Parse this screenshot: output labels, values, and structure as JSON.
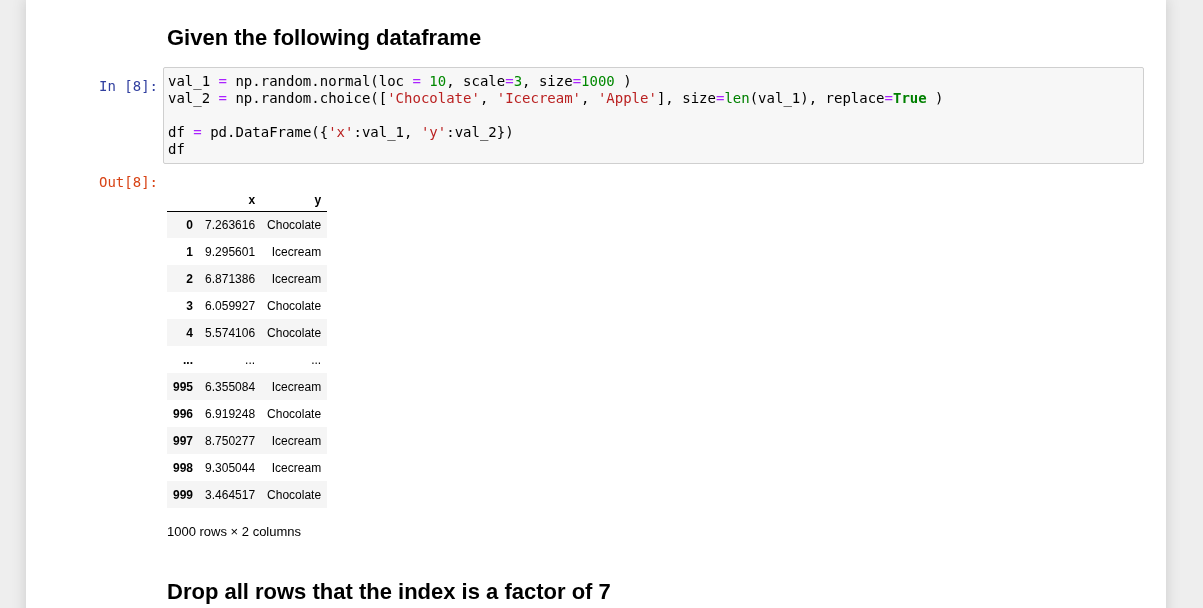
{
  "notebook": {
    "cells": [
      {
        "kind": "markdown",
        "heading": "Given the following dataframe"
      },
      {
        "kind": "code",
        "prompt": "In [8]:",
        "blocks": [
          [
            [
              {
                "kind": "plain",
                "text": "val_1 "
              },
              {
                "kind": "op",
                "text": "="
              },
              {
                "kind": "plain",
                "text": " np.random.normal(loc "
              },
              {
                "kind": "op",
                "text": "= "
              },
              {
                "kind": "number",
                "text": "10"
              },
              {
                "kind": "plain",
                "text": ", scale"
              },
              {
                "kind": "op",
                "text": "="
              },
              {
                "kind": "number",
                "text": "3"
              },
              {
                "kind": "plain",
                "text": ", size"
              },
              {
                "kind": "op",
                "text": "="
              },
              {
                "kind": "number",
                "text": "1000"
              },
              {
                "kind": "plain",
                "text": " )"
              }
            ],
            [
              {
                "kind": "plain",
                "text": "val_2 "
              },
              {
                "kind": "op",
                "text": "="
              },
              {
                "kind": "plain",
                "text": " np.random.choice(["
              },
              {
                "kind": "string",
                "text": "'Chocolate'"
              },
              {
                "kind": "plain",
                "text": ", "
              },
              {
                "kind": "string",
                "text": "'Icecream'"
              },
              {
                "kind": "plain",
                "text": ", "
              },
              {
                "kind": "string",
                "text": "'Apple'"
              },
              {
                "kind": "plain",
                "text": "], size"
              },
              {
                "kind": "op",
                "text": "="
              },
              {
                "kind": "builtin",
                "text": "len"
              },
              {
                "kind": "plain",
                "text": "(val_1), replace"
              },
              {
                "kind": "op",
                "text": "="
              },
              {
                "kind": "keyword",
                "text": "True"
              },
              {
                "kind": "plain",
                "text": " )"
              }
            ]
          ],
          [
            [
              {
                "kind": "plain",
                "text": "df "
              },
              {
                "kind": "op",
                "text": "="
              },
              {
                "kind": "plain",
                "text": " pd.DataFrame({"
              },
              {
                "kind": "string",
                "text": "'x'"
              },
              {
                "kind": "plain",
                "text": ":val_1, "
              },
              {
                "kind": "string",
                "text": "'y'"
              },
              {
                "kind": "plain",
                "text": ":val_2})"
              }
            ],
            [
              {
                "kind": "plain",
                "text": "df"
              }
            ]
          ]
        ],
        "output": {
          "prompt": "Out[8]:",
          "table": {
            "columns": [
              "x",
              "y"
            ],
            "rows": [
              {
                "index": "0",
                "values": [
                  "7.263616",
                  "Chocolate"
                ]
              },
              {
                "index": "1",
                "values": [
                  "9.295601",
                  "Icecream"
                ]
              },
              {
                "index": "2",
                "values": [
                  "6.871386",
                  "Icecream"
                ]
              },
              {
                "index": "3",
                "values": [
                  "6.059927",
                  "Chocolate"
                ]
              },
              {
                "index": "4",
                "values": [
                  "5.574106",
                  "Chocolate"
                ]
              },
              {
                "index": "...",
                "values": [
                  "...",
                  "..."
                ]
              },
              {
                "index": "995",
                "values": [
                  "6.355084",
                  "Icecream"
                ]
              },
              {
                "index": "996",
                "values": [
                  "6.919248",
                  "Chocolate"
                ]
              },
              {
                "index": "997",
                "values": [
                  "8.750277",
                  "Icecream"
                ]
              },
              {
                "index": "998",
                "values": [
                  "9.305044",
                  "Icecream"
                ]
              },
              {
                "index": "999",
                "values": [
                  "3.464517",
                  "Chocolate"
                ]
              }
            ]
          },
          "summary": "1000 rows × 2 columns"
        }
      },
      {
        "kind": "markdown",
        "heading": "Drop all rows that the index is a factor of 7"
      }
    ]
  }
}
